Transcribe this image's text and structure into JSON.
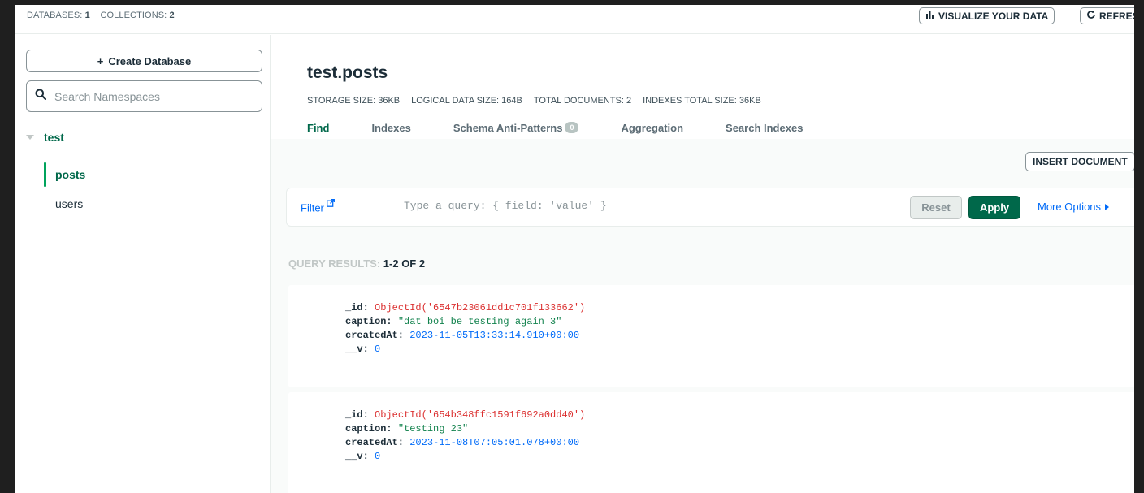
{
  "topbar": {
    "databases_label": "DATABASES:",
    "databases_count": "1",
    "collections_label": "COLLECTIONS:",
    "collections_count": "2",
    "visualize_label": "VISUALIZE YOUR DATA",
    "refresh_label": "REFRESH"
  },
  "sidebar": {
    "create_db_label": "Create Database",
    "search_placeholder": "Search Namespaces",
    "database": "test",
    "collections": [
      "posts",
      "users"
    ]
  },
  "main": {
    "title": "test.posts",
    "meta": {
      "storage": "STORAGE SIZE: 36KB",
      "logical": "LOGICAL DATA SIZE: 164B",
      "total_docs": "TOTAL DOCUMENTS: 2",
      "indexes": "INDEXES TOTAL SIZE: 36KB"
    },
    "tabs": [
      {
        "label": "Find",
        "active": true
      },
      {
        "label": "Indexes"
      },
      {
        "label": "Schema Anti-Patterns",
        "badge": "0"
      },
      {
        "label": "Aggregation"
      },
      {
        "label": "Search Indexes"
      }
    ]
  },
  "content": {
    "insert_label": "INSERT DOCUMENT",
    "filter_label": "Filter",
    "query_placeholder": "Type a query: { field: 'value' }",
    "reset_label": "Reset",
    "apply_label": "Apply",
    "more_options_label": "More Options",
    "results_label": "QUERY RESULTS:",
    "results_count": "1-2 OF 2",
    "documents": [
      {
        "id_key": "_id:",
        "id_val": "ObjectId('6547b23061dd1c701f133662')",
        "caption_key": "caption:",
        "caption_val": "\"dat boi be testing again 3\"",
        "created_key": "createdAt:",
        "created_val": "2023-11-05T13:33:14.910+00:00",
        "v_key": "__v:",
        "v_val": "0"
      },
      {
        "id_key": "_id:",
        "id_val": "ObjectId('654b348ffc1591f692a0dd40')",
        "caption_key": "caption:",
        "caption_val": "\"testing 23\"",
        "created_key": "createdAt:",
        "created_val": "2023-11-08T07:05:01.078+00:00",
        "v_key": "__v:",
        "v_val": "0"
      }
    ]
  },
  "colors": {
    "brand_green": "#00684a",
    "accent_green": "#00a35c",
    "link_blue": "#016bf8",
    "objectid_red": "#db3030"
  }
}
